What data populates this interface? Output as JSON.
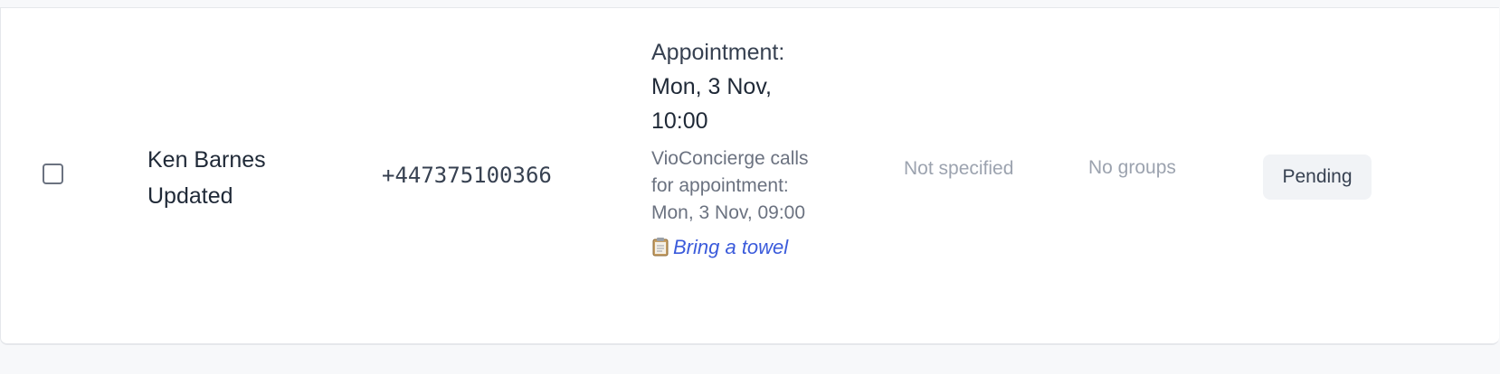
{
  "row": {
    "contact_name": "Ken Barnes Updated",
    "phone": "+447375100366",
    "appointment": {
      "title": "Appointment:",
      "time": "Mon, 3 Nov, 10:00",
      "description": "VioConcierge calls for appointment: Mon, 3 Nov, 09:00",
      "note_icon": "clipboard-icon",
      "note": "Bring a towel"
    },
    "unspecified_value": "Not specified",
    "groups": "No groups",
    "status": "Pending"
  },
  "colors": {
    "note_link": "#3b5bdb",
    "muted_text": "#9ca3af",
    "badge_bg": "#f1f3f6"
  }
}
